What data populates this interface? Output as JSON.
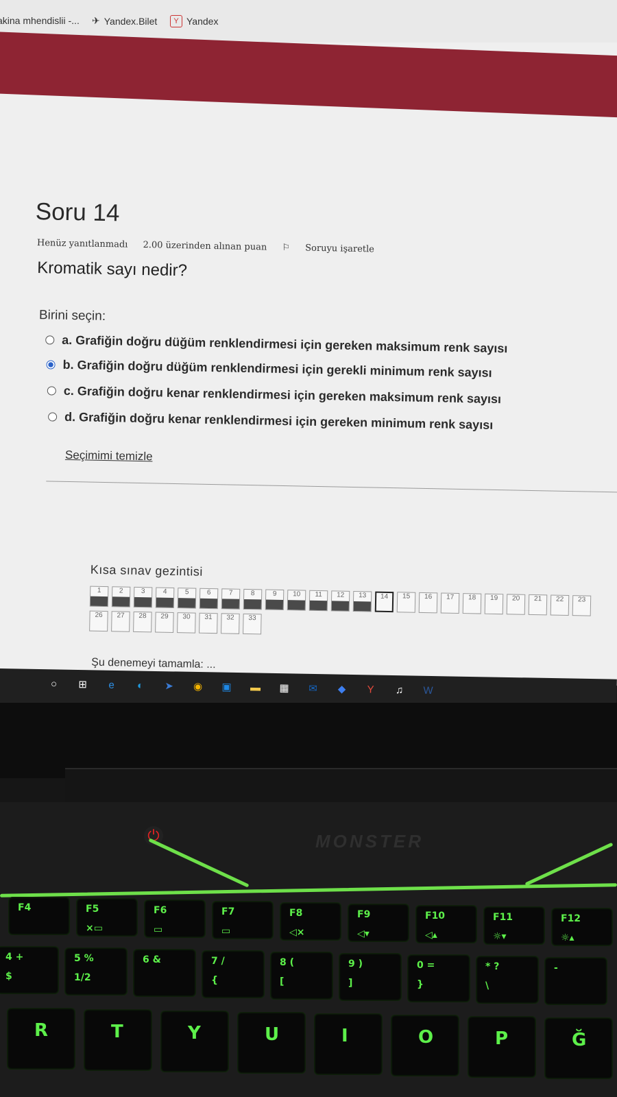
{
  "bookmarks": [
    {
      "label": "akina mhendislii -..."
    },
    {
      "icon": "plane-icon",
      "label": "Yandex.Bilet"
    },
    {
      "icon": "yandex-logo-icon",
      "label": "Yandex"
    }
  ],
  "colors": {
    "banner": "#8e2433",
    "selected_radio": "#2a62c9",
    "keyboard_glow": "#5df04a"
  },
  "question": {
    "title": "Soru 14",
    "status": "Henüz yanıtlanmadı",
    "points": "2.00 üzerinden alınan puan",
    "flag_label": "Soruyu işaretle",
    "text": "Kromatik sayı nedir?",
    "prompt": "Birini seçin:",
    "options": [
      {
        "label": "a. Grafiğin doğru düğüm renklendirmesi için gereken maksimum renk sayısı",
        "selected": false
      },
      {
        "label": "b. Grafiğin doğru düğüm renklendirmesi için gerekli minimum renk sayısı",
        "selected": true
      },
      {
        "label": "c. Grafiğin doğru kenar renklendirmesi için gereken maksimum renk sayısı",
        "selected": false
      },
      {
        "label": "d. Grafiğin doğru kenar renklendirmesi için gereken minimum renk sayısı",
        "selected": false
      }
    ],
    "clear_label": "Seçimimi temizle"
  },
  "quiz_nav": {
    "title": "Kısa sınav gezintisi",
    "row1": [
      "1",
      "2",
      "3",
      "4",
      "5",
      "6",
      "7",
      "8",
      "9",
      "10",
      "11",
      "12",
      "13",
      "14",
      "15",
      "16",
      "17",
      "18",
      "19",
      "20",
      "21",
      "22",
      "23"
    ],
    "row2": [
      "26",
      "27",
      "28",
      "29",
      "30",
      "31",
      "32",
      "33"
    ],
    "answered": [
      "1",
      "2",
      "3",
      "4",
      "5",
      "6",
      "7",
      "8",
      "9",
      "10",
      "11",
      "12",
      "13"
    ],
    "current": "14",
    "finish_label": "Şu denemeyi tamamla: ..."
  },
  "taskbar_icons": [
    "search-circle-icon",
    "task-view-icon",
    "internet-explorer-icon",
    "edge-icon",
    "arrow-app-icon",
    "chrome-icon",
    "store-icon",
    "file-explorer-icon",
    "calendar-icon",
    "mail-icon",
    "drop-icon",
    "yandex-browser-icon",
    "itunes-icon",
    "word-icon"
  ],
  "laptop": {
    "brand": "MONSTER",
    "keys_row1": [
      {
        "p": "F4",
        "s": ""
      },
      {
        "p": "F5",
        "s": "×▭"
      },
      {
        "p": "F6",
        "s": "▭"
      },
      {
        "p": "F7",
        "s": "▭"
      },
      {
        "p": "F8",
        "s": "◁×"
      },
      {
        "p": "F9",
        "s": "◁▾"
      },
      {
        "p": "F10",
        "s": "◁▴"
      },
      {
        "p": "F11",
        "s": "☼▾"
      },
      {
        "p": "F12",
        "s": "☼▴"
      }
    ],
    "keys_row2": [
      {
        "p": "4 +",
        "s": "$"
      },
      {
        "p": "5 %",
        "s": "1/2"
      },
      {
        "p": "6 &",
        "s": ""
      },
      {
        "p": "7 /",
        "s": "{"
      },
      {
        "p": "8 (",
        "s": "["
      },
      {
        "p": "9 )",
        "s": "]"
      },
      {
        "p": "0 =",
        "s": "}"
      },
      {
        "p": "* ?",
        "s": "\\"
      },
      {
        "p": "-",
        "s": ""
      }
    ],
    "keys_row3": [
      "R",
      "T",
      "Y",
      "U",
      "I",
      "O",
      "P",
      "Ğ"
    ]
  }
}
